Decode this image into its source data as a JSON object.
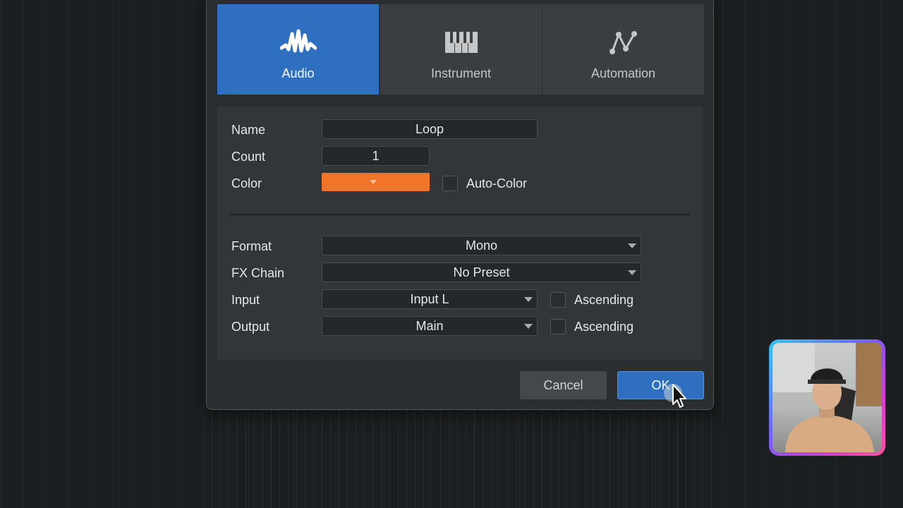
{
  "track_types": [
    {
      "label": "Audio",
      "icon": "waveform-icon",
      "active": true
    },
    {
      "label": "Instrument",
      "icon": "keyboard-icon",
      "active": false
    },
    {
      "label": "Automation",
      "icon": "automation-curve-icon",
      "active": false
    }
  ],
  "form": {
    "name": {
      "label": "Name",
      "value": "Loop"
    },
    "count": {
      "label": "Count",
      "value": "1"
    },
    "color": {
      "label": "Color",
      "value": "#f07528",
      "auto_label": "Auto-Color"
    },
    "format": {
      "label": "Format",
      "value": "Mono"
    },
    "fx_chain": {
      "label": "FX Chain",
      "value": "No Preset"
    },
    "input": {
      "label": "Input",
      "value": "Input L",
      "check_label": "Ascending"
    },
    "output": {
      "label": "Output",
      "value": "Main",
      "check_label": "Ascending"
    }
  },
  "buttons": {
    "cancel": "Cancel",
    "ok": "OK"
  },
  "colors": {
    "accent": "#2f6fbf",
    "track_color": "#f07528",
    "dialog_bg": "#2b2e31"
  }
}
